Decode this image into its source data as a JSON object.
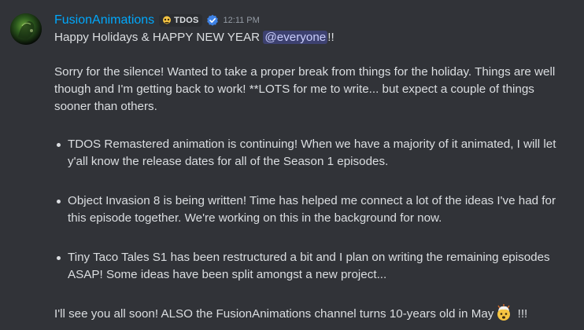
{
  "message": {
    "author": {
      "username": "FusionAnimations",
      "avatar_icon": "avatar-image",
      "tag_icon": "skull-emoji-icon",
      "tag_text": "TDOS",
      "verified_icon": "verified-check-icon",
      "color": "#00a8fc"
    },
    "timestamp": "12:11 PM",
    "greeting_text": "Happy Holidays & HAPPY NEW YEAR ",
    "mention": "@everyone",
    "greeting_end": "!!",
    "paragraph_1": "Sorry for the silence! Wanted to take a proper break from things for the holiday. Things are well though and I'm getting back to work! **LOTS for me to write... but expect a couple of things sooner than others.",
    "bullets": [
      "TDOS Remastered animation is continuing! When we have a majority of it animated, I will let y'all know the release dates for all of the Season 1 episodes.",
      "Object Invasion 8 is being written! Time has helped me connect a lot of the ideas I've had for this episode together. We're working on this in the background for now.",
      "Tiny Taco Tales S1 has been restructured a bit and I plan on writing the remaining episodes ASAP! Some ideas have been split amongst a new project..."
    ],
    "closing_text": "I'll see you all soon! ALSO the FusionAnimations channel turns 10-years old in May",
    "closing_emoji": "exploding-head-emoji-icon",
    "closing_end": " !!!"
  },
  "colors": {
    "background": "#313338",
    "text": "#dbdee1",
    "timestamp": "#949ba4",
    "mention_bg": "#3c4270",
    "mention_text": "#c9cdfb"
  }
}
